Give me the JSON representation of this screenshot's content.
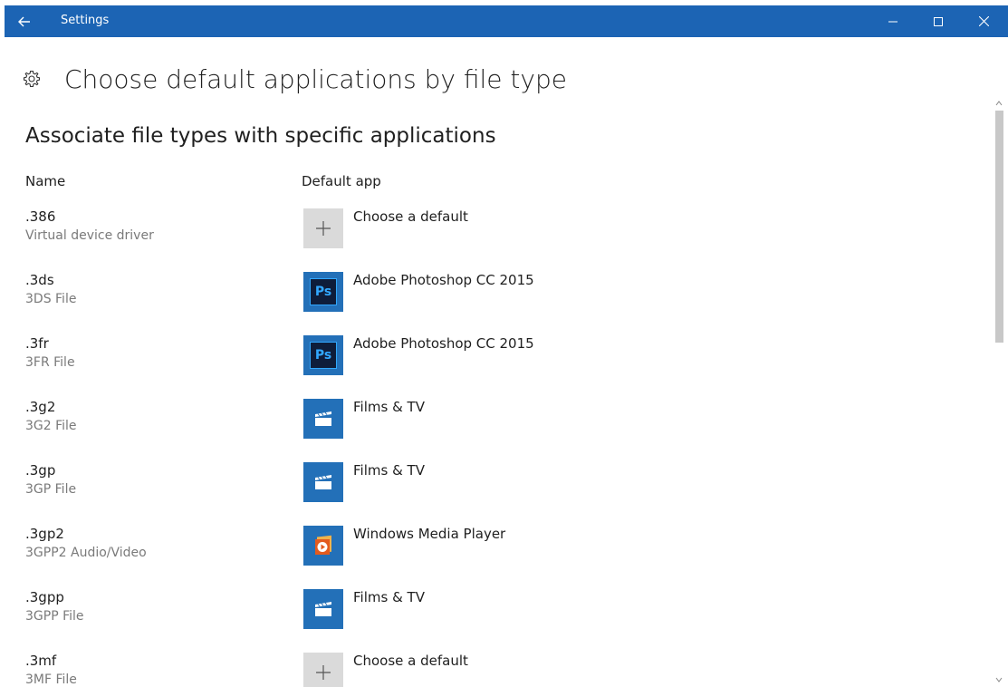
{
  "window": {
    "title": "Settings"
  },
  "header": {
    "title": "Choose default applications by file type",
    "icon": "gear-icon"
  },
  "section": {
    "title": "Associate file types with specific applications"
  },
  "columns": {
    "name": "Name",
    "default_app": "Default app"
  },
  "rows": [
    {
      "ext": ".386",
      "desc": "Virtual device driver",
      "app": "Choose a default",
      "icon": "plus-icon"
    },
    {
      "ext": ".3ds",
      "desc": "3DS File",
      "app": "Adobe Photoshop CC 2015",
      "icon": "photoshop-icon"
    },
    {
      "ext": ".3fr",
      "desc": "3FR File",
      "app": "Adobe Photoshop CC 2015",
      "icon": "photoshop-icon"
    },
    {
      "ext": ".3g2",
      "desc": "3G2 File",
      "app": "Films & TV",
      "icon": "films-tv-icon"
    },
    {
      "ext": ".3gp",
      "desc": "3GP File",
      "app": "Films & TV",
      "icon": "films-tv-icon"
    },
    {
      "ext": ".3gp2",
      "desc": "3GPP2 Audio/Video",
      "app": "Windows Media Player",
      "icon": "windows-media-player-icon"
    },
    {
      "ext": ".3gpp",
      "desc": "3GPP File",
      "app": "Films & TV",
      "icon": "films-tv-icon"
    },
    {
      "ext": ".3mf",
      "desc": "3MF File",
      "app": "Choose a default",
      "icon": "plus-icon"
    }
  ],
  "ps_label": "Ps",
  "colors": {
    "titlebar": "#1c64b4",
    "tile_blue": "#2370b8",
    "tile_gray": "#dadada"
  }
}
